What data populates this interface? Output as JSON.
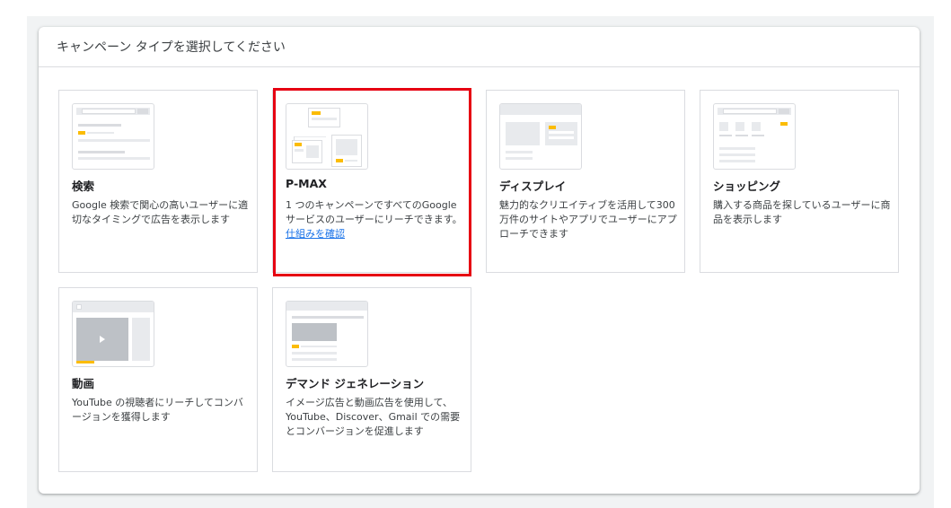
{
  "header": {
    "title": "キャンペーン タイプを選択してください"
  },
  "cards": [
    {
      "title": "検索",
      "desc": "Google 検索で関心の高いユーザーに適切なタイミングで広告を表示します",
      "link": ""
    },
    {
      "title": "P-MAX",
      "desc": "1 つのキャンペーンですべてのGoogle サービスのユーザーにリーチできます。",
      "link": "仕組みを確認"
    },
    {
      "title": "ディスプレイ",
      "desc": "魅力的なクリエイティブを活用して300 万件のサイトやアプリでユーザーにアプローチできます",
      "link": ""
    },
    {
      "title": "ショッピング",
      "desc": "購入する商品を探しているユーザーに商品を表示します",
      "link": ""
    },
    {
      "title": "動画",
      "desc": "YouTube の視聴者にリーチしてコンバージョンを獲得します",
      "link": ""
    },
    {
      "title": "デマンド ジェネレーション",
      "desc": "イメージ広告と動画広告を使用して、YouTube、Discover、Gmail での需要とコンバージョンを促進します",
      "link": ""
    }
  ],
  "colors": {
    "highlight": "#e60012",
    "accent": "#fbbc04",
    "link": "#1a73e8"
  }
}
